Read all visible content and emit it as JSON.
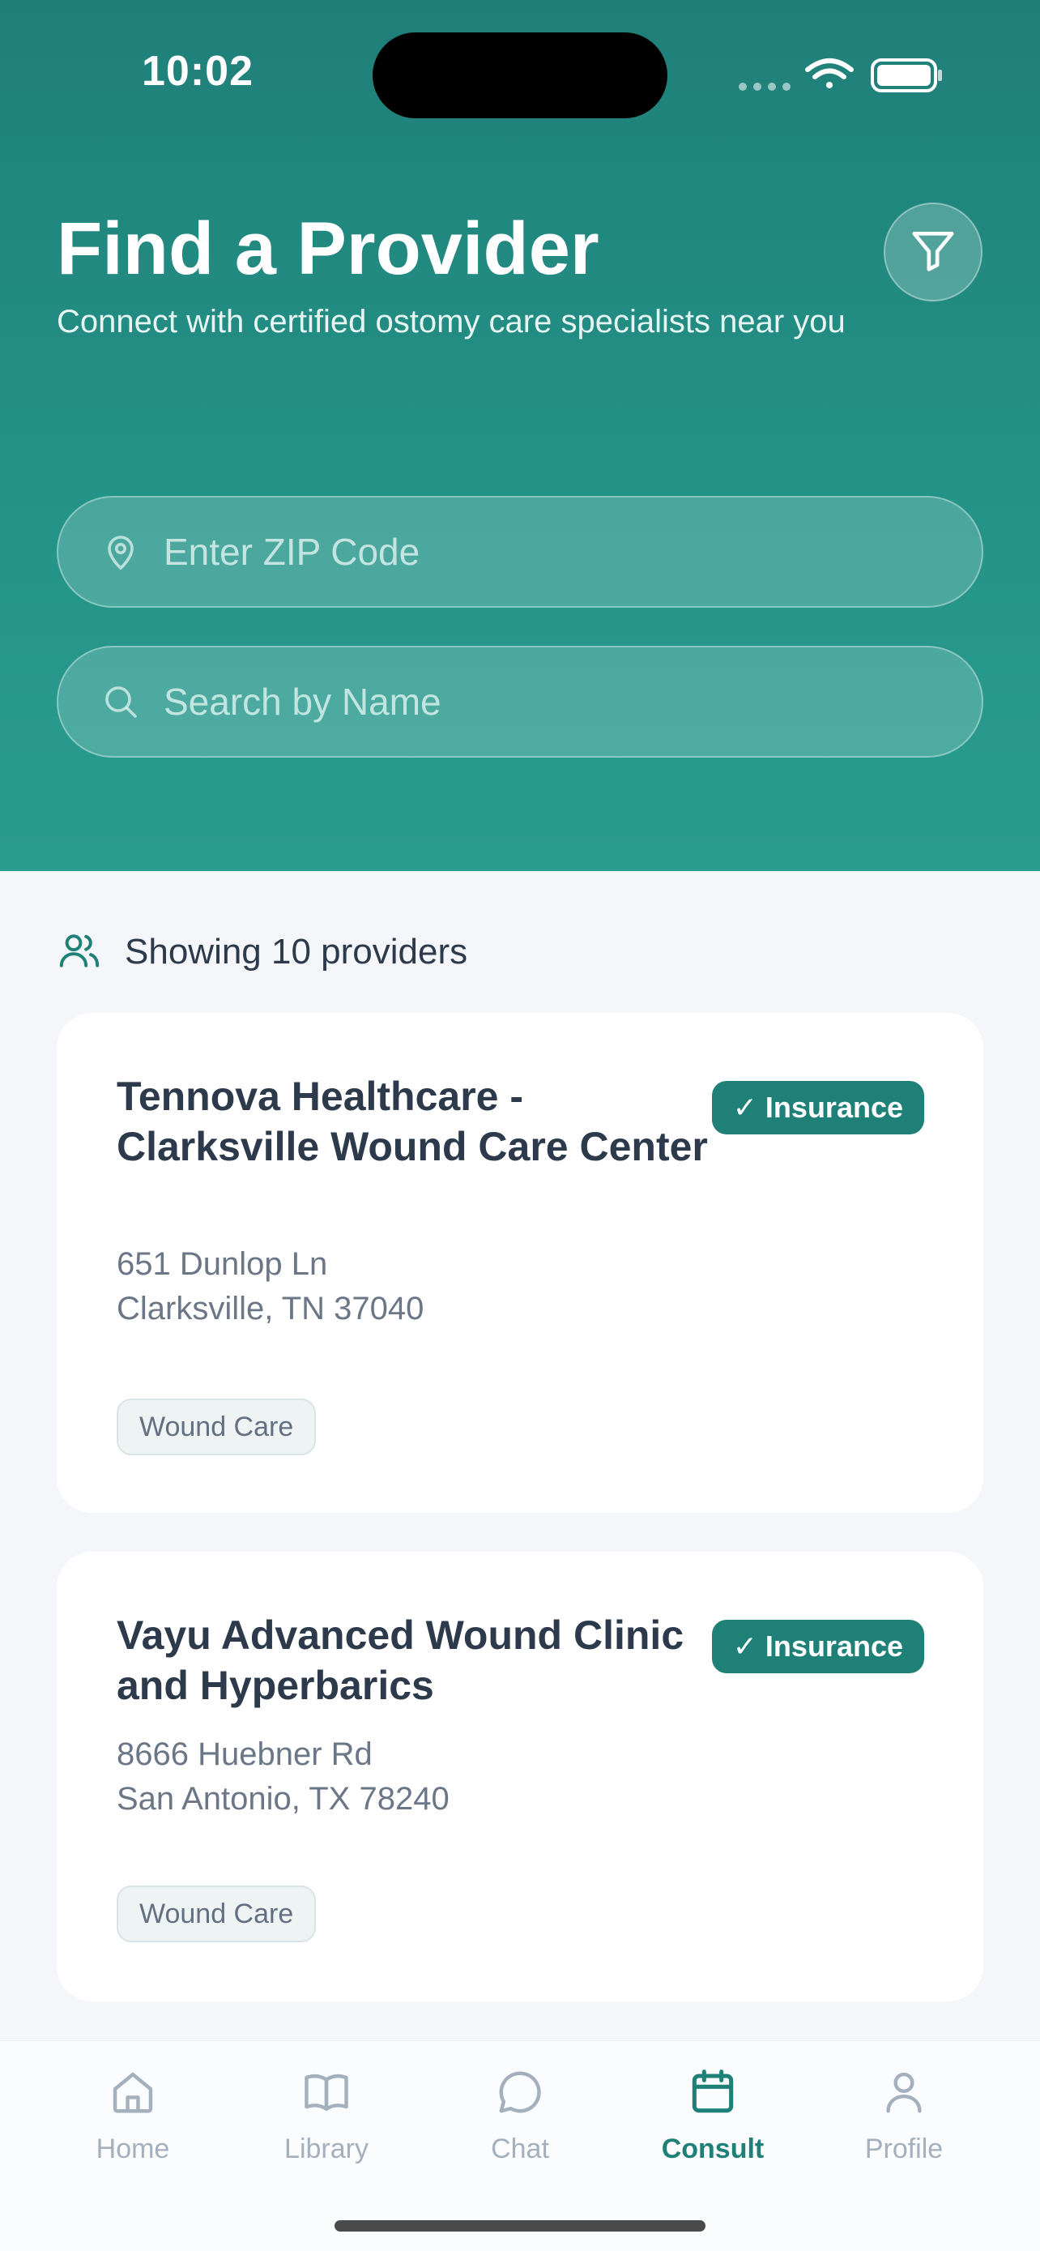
{
  "status_bar": {
    "time": "10:02"
  },
  "header": {
    "title": "Find a Provider",
    "subtitle": "Connect with certified ostomy care specialists near you"
  },
  "search": {
    "zip_placeholder": "Enter ZIP Code",
    "name_placeholder": "Search by Name"
  },
  "results": {
    "count_text": "Showing 10 providers"
  },
  "providers": [
    {
      "name": "Tennova Healthcare - Clarksville Wound Care Center",
      "badge": "✓ Insurance",
      "address_line1": "651 Dunlop Ln",
      "address_line2": "Clarksville, TN 37040",
      "tag": "Wound Care"
    },
    {
      "name": "Vayu Advanced Wound Clinic and Hyperbarics",
      "badge": "✓ Insurance",
      "address_line1": "8666 Huebner Rd",
      "address_line2": "San Antonio, TX 78240",
      "tag": "Wound Care"
    }
  ],
  "tab_bar": {
    "tabs": [
      {
        "label": "Home",
        "icon": "home-icon"
      },
      {
        "label": "Library",
        "icon": "book-icon"
      },
      {
        "label": "Chat",
        "icon": "chat-bubble-icon"
      },
      {
        "label": "Consult",
        "icon": "calendar-icon",
        "active": true
      },
      {
        "label": "Profile",
        "icon": "person-icon"
      }
    ]
  },
  "colors": {
    "header_gradient_top": "#1f7f78",
    "header_gradient_bottom": "#2a9c8f",
    "accent": "#1f8077",
    "inactive_tab": "#a4b0bd",
    "page_background": "#f4f6f9"
  }
}
